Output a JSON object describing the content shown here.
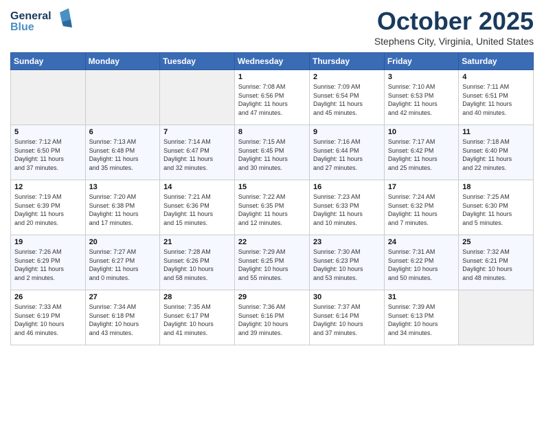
{
  "header": {
    "logo_line1": "General",
    "logo_line2": "Blue",
    "month": "October 2025",
    "location": "Stephens City, Virginia, United States"
  },
  "weekdays": [
    "Sunday",
    "Monday",
    "Tuesday",
    "Wednesday",
    "Thursday",
    "Friday",
    "Saturday"
  ],
  "weeks": [
    [
      {
        "day": "",
        "info": ""
      },
      {
        "day": "",
        "info": ""
      },
      {
        "day": "",
        "info": ""
      },
      {
        "day": "1",
        "info": "Sunrise: 7:08 AM\nSunset: 6:56 PM\nDaylight: 11 hours\nand 47 minutes."
      },
      {
        "day": "2",
        "info": "Sunrise: 7:09 AM\nSunset: 6:54 PM\nDaylight: 11 hours\nand 45 minutes."
      },
      {
        "day": "3",
        "info": "Sunrise: 7:10 AM\nSunset: 6:53 PM\nDaylight: 11 hours\nand 42 minutes."
      },
      {
        "day": "4",
        "info": "Sunrise: 7:11 AM\nSunset: 6:51 PM\nDaylight: 11 hours\nand 40 minutes."
      }
    ],
    [
      {
        "day": "5",
        "info": "Sunrise: 7:12 AM\nSunset: 6:50 PM\nDaylight: 11 hours\nand 37 minutes."
      },
      {
        "day": "6",
        "info": "Sunrise: 7:13 AM\nSunset: 6:48 PM\nDaylight: 11 hours\nand 35 minutes."
      },
      {
        "day": "7",
        "info": "Sunrise: 7:14 AM\nSunset: 6:47 PM\nDaylight: 11 hours\nand 32 minutes."
      },
      {
        "day": "8",
        "info": "Sunrise: 7:15 AM\nSunset: 6:45 PM\nDaylight: 11 hours\nand 30 minutes."
      },
      {
        "day": "9",
        "info": "Sunrise: 7:16 AM\nSunset: 6:44 PM\nDaylight: 11 hours\nand 27 minutes."
      },
      {
        "day": "10",
        "info": "Sunrise: 7:17 AM\nSunset: 6:42 PM\nDaylight: 11 hours\nand 25 minutes."
      },
      {
        "day": "11",
        "info": "Sunrise: 7:18 AM\nSunset: 6:40 PM\nDaylight: 11 hours\nand 22 minutes."
      }
    ],
    [
      {
        "day": "12",
        "info": "Sunrise: 7:19 AM\nSunset: 6:39 PM\nDaylight: 11 hours\nand 20 minutes."
      },
      {
        "day": "13",
        "info": "Sunrise: 7:20 AM\nSunset: 6:38 PM\nDaylight: 11 hours\nand 17 minutes."
      },
      {
        "day": "14",
        "info": "Sunrise: 7:21 AM\nSunset: 6:36 PM\nDaylight: 11 hours\nand 15 minutes."
      },
      {
        "day": "15",
        "info": "Sunrise: 7:22 AM\nSunset: 6:35 PM\nDaylight: 11 hours\nand 12 minutes."
      },
      {
        "day": "16",
        "info": "Sunrise: 7:23 AM\nSunset: 6:33 PM\nDaylight: 11 hours\nand 10 minutes."
      },
      {
        "day": "17",
        "info": "Sunrise: 7:24 AM\nSunset: 6:32 PM\nDaylight: 11 hours\nand 7 minutes."
      },
      {
        "day": "18",
        "info": "Sunrise: 7:25 AM\nSunset: 6:30 PM\nDaylight: 11 hours\nand 5 minutes."
      }
    ],
    [
      {
        "day": "19",
        "info": "Sunrise: 7:26 AM\nSunset: 6:29 PM\nDaylight: 11 hours\nand 2 minutes."
      },
      {
        "day": "20",
        "info": "Sunrise: 7:27 AM\nSunset: 6:27 PM\nDaylight: 11 hours\nand 0 minutes."
      },
      {
        "day": "21",
        "info": "Sunrise: 7:28 AM\nSunset: 6:26 PM\nDaylight: 10 hours\nand 58 minutes."
      },
      {
        "day": "22",
        "info": "Sunrise: 7:29 AM\nSunset: 6:25 PM\nDaylight: 10 hours\nand 55 minutes."
      },
      {
        "day": "23",
        "info": "Sunrise: 7:30 AM\nSunset: 6:23 PM\nDaylight: 10 hours\nand 53 minutes."
      },
      {
        "day": "24",
        "info": "Sunrise: 7:31 AM\nSunset: 6:22 PM\nDaylight: 10 hours\nand 50 minutes."
      },
      {
        "day": "25",
        "info": "Sunrise: 7:32 AM\nSunset: 6:21 PM\nDaylight: 10 hours\nand 48 minutes."
      }
    ],
    [
      {
        "day": "26",
        "info": "Sunrise: 7:33 AM\nSunset: 6:19 PM\nDaylight: 10 hours\nand 46 minutes."
      },
      {
        "day": "27",
        "info": "Sunrise: 7:34 AM\nSunset: 6:18 PM\nDaylight: 10 hours\nand 43 minutes."
      },
      {
        "day": "28",
        "info": "Sunrise: 7:35 AM\nSunset: 6:17 PM\nDaylight: 10 hours\nand 41 minutes."
      },
      {
        "day": "29",
        "info": "Sunrise: 7:36 AM\nSunset: 6:16 PM\nDaylight: 10 hours\nand 39 minutes."
      },
      {
        "day": "30",
        "info": "Sunrise: 7:37 AM\nSunset: 6:14 PM\nDaylight: 10 hours\nand 37 minutes."
      },
      {
        "day": "31",
        "info": "Sunrise: 7:39 AM\nSunset: 6:13 PM\nDaylight: 10 hours\nand 34 minutes."
      },
      {
        "day": "",
        "info": ""
      }
    ]
  ]
}
